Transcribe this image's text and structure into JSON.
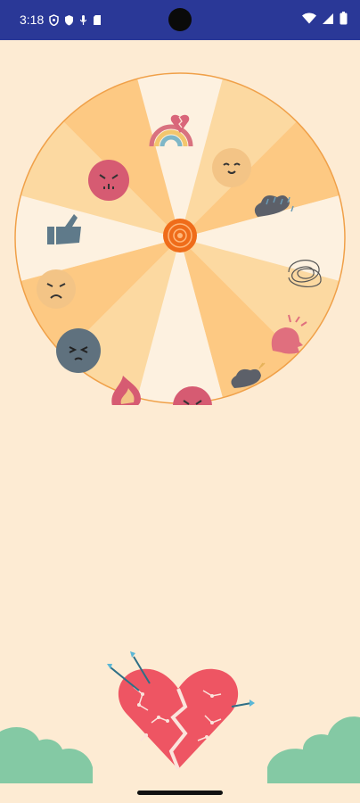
{
  "status_bar": {
    "time": "3:18",
    "icons_left": [
      "shield-icon",
      "shield-filled-icon",
      "mic-icon",
      "sd-card-icon"
    ],
    "icons_right": [
      "wifi-icon",
      "signal-icon",
      "battery-icon"
    ],
    "background": "#2a3897"
  },
  "wheel": {
    "segments": [
      {
        "icon": "rainbow-icon",
        "color": "#fdf1e0"
      },
      {
        "icon": "smiling-face-icon",
        "color": "#fcd9a1"
      },
      {
        "icon": "rain-cloud-icon",
        "color": "#fdc983"
      },
      {
        "icon": "scribble-icon",
        "color": "#fdf1e0"
      },
      {
        "icon": "shouting-head-icon",
        "color": "#fcd9a1"
      },
      {
        "icon": "storm-cloud-icon",
        "color": "#fdc983"
      },
      {
        "icon": "angry-face-icon",
        "color": "#fdf1e0"
      },
      {
        "icon": "flame-icon",
        "color": "#fcd9a1"
      },
      {
        "icon": "frustrated-face-icon",
        "color": "#fdc983"
      },
      {
        "icon": "frowning-face-icon",
        "color": "#fdf1e0"
      },
      {
        "icon": "thumbs-up-icon",
        "color": "#fcd9a1"
      },
      {
        "icon": "upset-face-icon",
        "color": "#fdc983"
      }
    ],
    "rim_color": "#f0a048",
    "hub_color": "#ef6c1a"
  },
  "theme": {
    "background": "#fdebd3",
    "heart_color": "#ee5563",
    "bush_color": "#84c9a4"
  }
}
